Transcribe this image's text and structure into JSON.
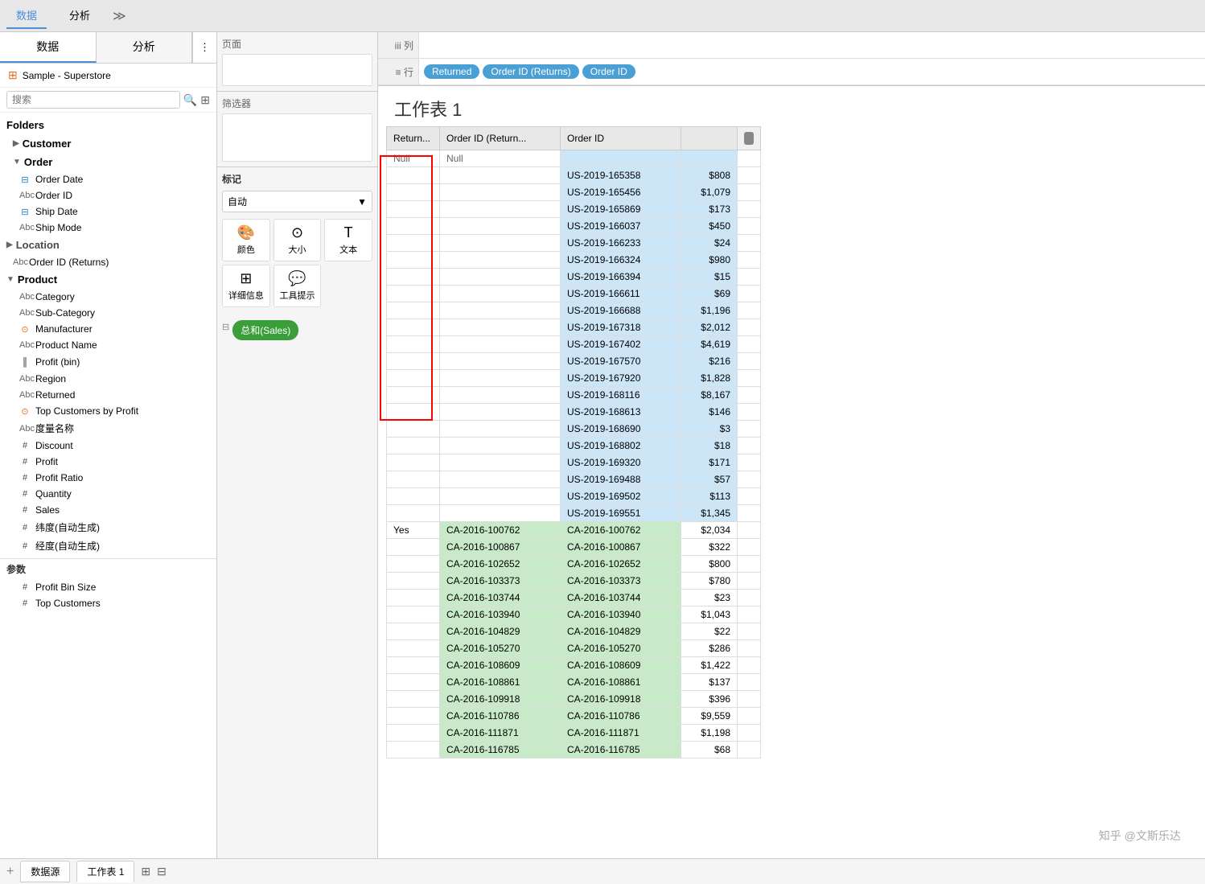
{
  "tabs": {
    "data_label": "数据",
    "analysis_label": "分析"
  },
  "left_panel": {
    "tab_data": "数据",
    "tab_analysis": "分析",
    "datasource": "Sample - Superstore",
    "search_placeholder": "搜索",
    "folders_label": "Folders",
    "customer_folder": "Customer",
    "order_folder": "Order",
    "order_fields": [
      {
        "name": "Order Date",
        "type": "date"
      },
      {
        "name": "Order ID",
        "type": "string"
      },
      {
        "name": "Ship Date",
        "type": "date"
      },
      {
        "name": "Ship Mode",
        "type": "string"
      }
    ],
    "location_folder": "Location",
    "order_id_returns": "Order ID (Returns)",
    "product_folder": "Product",
    "product_fields": [
      {
        "name": "Category",
        "type": "string"
      },
      {
        "name": "Sub-Category",
        "type": "string"
      },
      {
        "name": "Manufacturer",
        "type": "geo"
      },
      {
        "name": "Product Name",
        "type": "string"
      }
    ],
    "measures": [
      {
        "name": "Profit (bin)",
        "type": "measure"
      },
      {
        "name": "Region",
        "type": "string"
      },
      {
        "name": "Returned",
        "type": "string"
      },
      {
        "name": "Top Customers by Profit",
        "type": "set"
      },
      {
        "name": "度量名称",
        "type": "string"
      },
      {
        "name": "Discount",
        "type": "measure"
      },
      {
        "name": "Profit",
        "type": "measure"
      },
      {
        "name": "Profit Ratio",
        "type": "measure"
      },
      {
        "name": "Quantity",
        "type": "measure"
      },
      {
        "name": "Sales",
        "type": "measure"
      },
      {
        "name": "纬度(自动生成)",
        "type": "measure"
      },
      {
        "name": "经度(自动生成)",
        "type": "measure"
      }
    ],
    "params_label": "参数",
    "params": [
      {
        "name": "Profit Bin Size",
        "type": "param"
      },
      {
        "name": "Top Customers",
        "type": "param"
      }
    ]
  },
  "middle_panel": {
    "pages_label": "页面",
    "filters_label": "筛选器",
    "marks_label": "标记",
    "auto_label": "自动",
    "color_label": "颜色",
    "size_label": "大小",
    "text_label": "文本",
    "detail_label": "详细信息",
    "tooltip_label": "工具提示",
    "sum_sales_label": "总和(Sales)"
  },
  "shelf": {
    "columns_label": "iii 列",
    "rows_label": "≡ 行",
    "pills": {
      "returned": "Returned",
      "order_id_returns": "Order ID (Returns)",
      "order_id": "Order ID"
    }
  },
  "view": {
    "title": "工作表 1",
    "headers": {
      "returned": "Return...",
      "order_id_returns": "Order ID (Return...",
      "order_id": "Order ID",
      "null_label": "Null",
      "null_label2": "Null"
    },
    "null_rows": [
      {
        "returned": "",
        "order_id_returns": "",
        "order_id": "US-2019-165358",
        "sales": "$808"
      },
      {
        "returned": "",
        "order_id_returns": "",
        "order_id": "US-2019-165456",
        "sales": "$1,079"
      },
      {
        "returned": "",
        "order_id_returns": "",
        "order_id": "US-2019-165869",
        "sales": "$173"
      },
      {
        "returned": "",
        "order_id_returns": "",
        "order_id": "US-2019-166037",
        "sales": "$450"
      },
      {
        "returned": "",
        "order_id_returns": "",
        "order_id": "US-2019-166233",
        "sales": "$24"
      },
      {
        "returned": "",
        "order_id_returns": "",
        "order_id": "US-2019-166324",
        "sales": "$980"
      },
      {
        "returned": "",
        "order_id_returns": "",
        "order_id": "US-2019-166394",
        "sales": "$15"
      },
      {
        "returned": "",
        "order_id_returns": "",
        "order_id": "US-2019-166611",
        "sales": "$69"
      },
      {
        "returned": "",
        "order_id_returns": "",
        "order_id": "US-2019-166688",
        "sales": "$1,196"
      },
      {
        "returned": "",
        "order_id_returns": "",
        "order_id": "US-2019-167318",
        "sales": "$2,012"
      },
      {
        "returned": "",
        "order_id_returns": "",
        "order_id": "US-2019-167402",
        "sales": "$4,619"
      },
      {
        "returned": "",
        "order_id_returns": "",
        "order_id": "US-2019-167570",
        "sales": "$216"
      },
      {
        "returned": "",
        "order_id_returns": "",
        "order_id": "US-2019-167920",
        "sales": "$1,828"
      },
      {
        "returned": "",
        "order_id_returns": "",
        "order_id": "US-2019-168116",
        "sales": "$8,167"
      },
      {
        "returned": "",
        "order_id_returns": "",
        "order_id": "US-2019-168613",
        "sales": "$146"
      },
      {
        "returned": "",
        "order_id_returns": "",
        "order_id": "US-2019-168690",
        "sales": "$3"
      },
      {
        "returned": "",
        "order_id_returns": "",
        "order_id": "US-2019-168802",
        "sales": "$18"
      },
      {
        "returned": "",
        "order_id_returns": "",
        "order_id": "US-2019-169320",
        "sales": "$171"
      },
      {
        "returned": "",
        "order_id_returns": "",
        "order_id": "US-2019-169488",
        "sales": "$57"
      },
      {
        "returned": "",
        "order_id_returns": "",
        "order_id": "US-2019-169502",
        "sales": "$113"
      },
      {
        "returned": "",
        "order_id_returns": "",
        "order_id": "US-2019-169551",
        "sales": "$1,345"
      }
    ],
    "yes_rows": [
      {
        "returned": "Yes",
        "order_id_returns": "CA-2016-100762",
        "order_id": "CA-2016-100762",
        "sales": "$2,034"
      },
      {
        "returned": "",
        "order_id_returns": "CA-2016-100867",
        "order_id": "CA-2016-100867",
        "sales": "$322"
      },
      {
        "returned": "",
        "order_id_returns": "CA-2016-102652",
        "order_id": "CA-2016-102652",
        "sales": "$800"
      },
      {
        "returned": "",
        "order_id_returns": "CA-2016-103373",
        "order_id": "CA-2016-103373",
        "sales": "$780"
      },
      {
        "returned": "",
        "order_id_returns": "CA-2016-103744",
        "order_id": "CA-2016-103744",
        "sales": "$23"
      },
      {
        "returned": "",
        "order_id_returns": "CA-2016-103940",
        "order_id": "CA-2016-103940",
        "sales": "$1,043"
      },
      {
        "returned": "",
        "order_id_returns": "CA-2016-104829",
        "order_id": "CA-2016-104829",
        "sales": "$22"
      },
      {
        "returned": "",
        "order_id_returns": "CA-2016-105270",
        "order_id": "CA-2016-105270",
        "sales": "$286"
      },
      {
        "returned": "",
        "order_id_returns": "CA-2016-108609",
        "order_id": "CA-2016-108609",
        "sales": "$1,422"
      },
      {
        "returned": "",
        "order_id_returns": "CA-2016-108861",
        "order_id": "CA-2016-108861",
        "sales": "$137"
      },
      {
        "returned": "",
        "order_id_returns": "CA-2016-109918",
        "order_id": "CA-2016-109918",
        "sales": "$396"
      },
      {
        "returned": "",
        "order_id_returns": "CA-2016-110786",
        "order_id": "CA-2016-110786",
        "sales": "$9,559"
      },
      {
        "returned": "",
        "order_id_returns": "CA-2016-111871",
        "order_id": "CA-2016-111871",
        "sales": "$1,198"
      },
      {
        "returned": "",
        "order_id_returns": "CA-2016-116785",
        "order_id": "CA-2016-116785",
        "sales": "$68"
      }
    ]
  },
  "bottom_tabs": [
    {
      "label": "数据源"
    },
    {
      "label": "工作表 1",
      "active": true
    },
    {
      "label": "III"
    },
    {
      "label": "图"
    }
  ],
  "watermark": "知乎 @文斯乐达"
}
